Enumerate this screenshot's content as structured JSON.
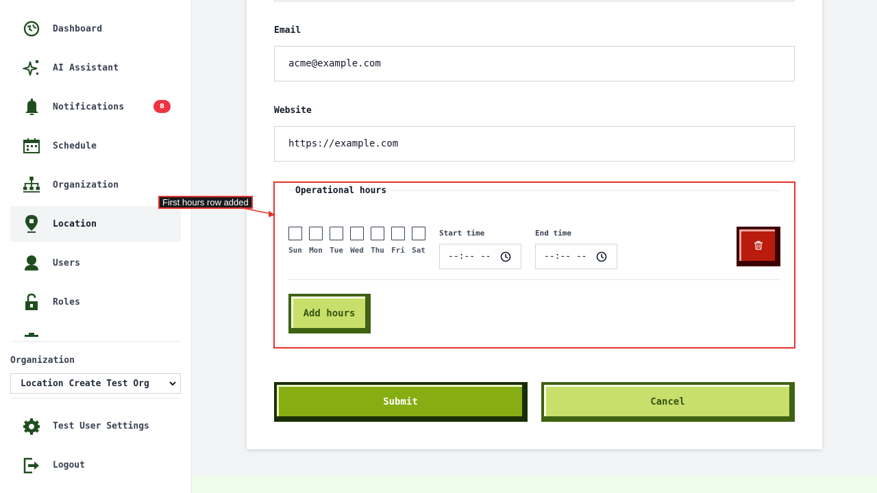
{
  "sidebar": {
    "items": [
      {
        "label": "Dashboard",
        "icon": "dashboard-icon"
      },
      {
        "label": "AI Assistant",
        "icon": "sparkle-icon"
      },
      {
        "label": "Notifications",
        "icon": "bell-icon",
        "badge": "8"
      },
      {
        "label": "Schedule",
        "icon": "calendar-icon"
      },
      {
        "label": "Organization",
        "icon": "org-chart-icon"
      },
      {
        "label": "Location",
        "icon": "location-pin-icon",
        "active": true
      },
      {
        "label": "Users",
        "icon": "user-icon"
      },
      {
        "label": "Roles",
        "icon": "lock-icon"
      }
    ],
    "organization_label": "Organization",
    "organization_selected": "Location Create Test Org",
    "settings_label": "Test User Settings",
    "logout_label": "Logout"
  },
  "form": {
    "email_label": "Email",
    "email_value": "acme@example.com",
    "website_label": "Website",
    "website_value": "https://example.com",
    "hours_legend": "Operational hours",
    "days": [
      "Sun",
      "Mon",
      "Tue",
      "Wed",
      "Thu",
      "Fri",
      "Sat"
    ],
    "start_time_label": "Start time",
    "start_time_value": "--:-- --",
    "end_time_label": "End time",
    "end_time_value": "--:-- --",
    "add_hours_label": "Add hours",
    "submit_label": "Submit",
    "cancel_label": "Cancel"
  },
  "annotation": {
    "callout_text": "First hours row added"
  },
  "colors": {
    "icon_green": "#1f4d1f",
    "badge_red": "#ef3340",
    "submit_green": "#86ad12",
    "cancel_lime": "#c8e06b",
    "delete_red": "#b91c0c",
    "highlight_red": "#e5322d"
  }
}
